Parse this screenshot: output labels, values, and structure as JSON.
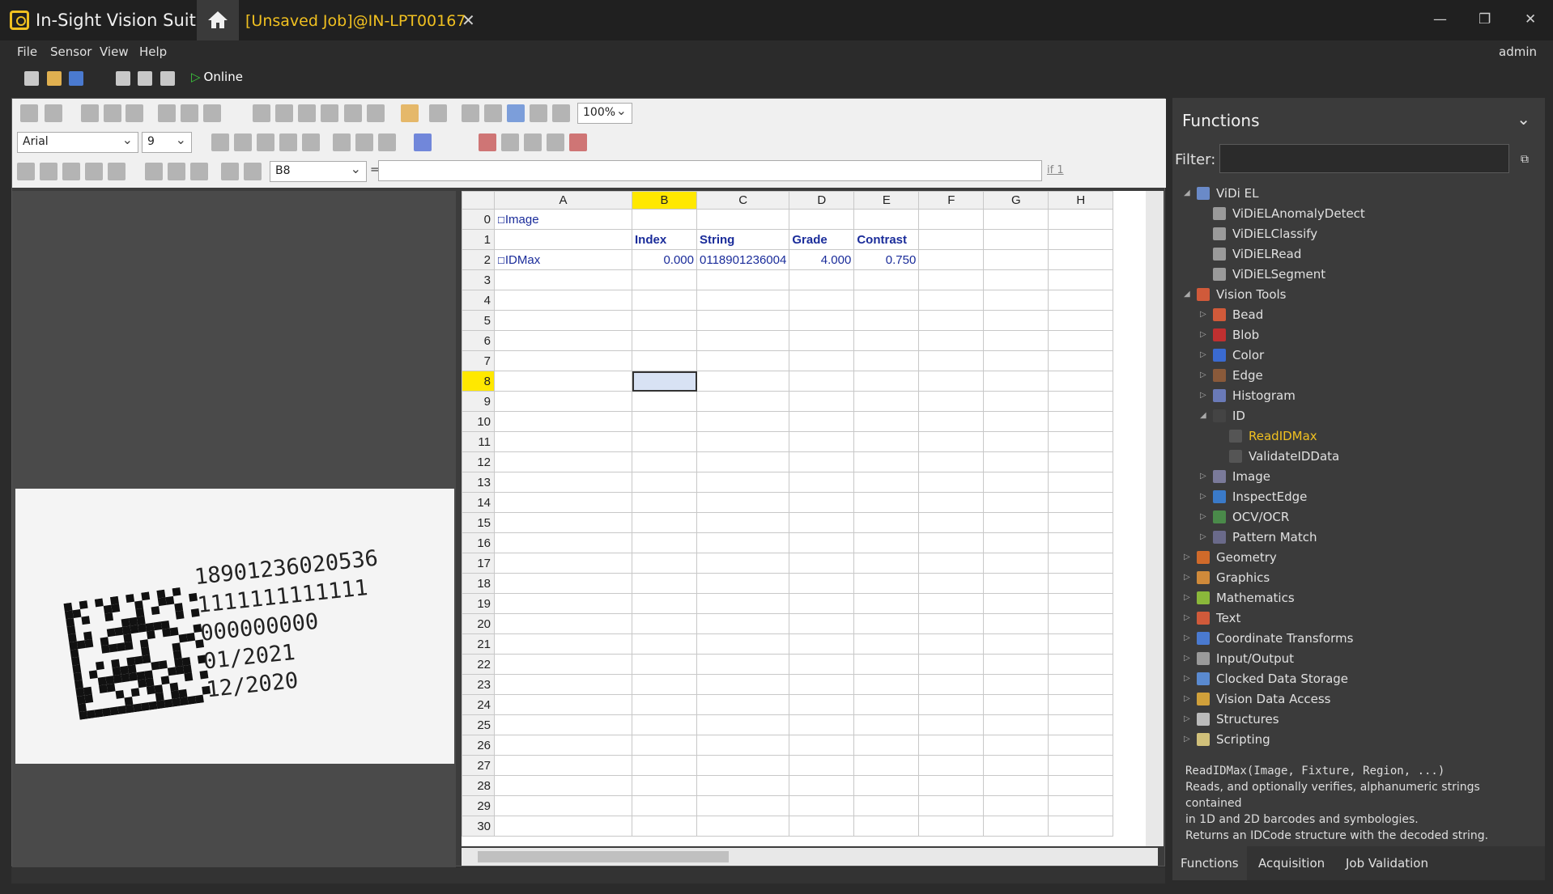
{
  "app": {
    "title": "In-Sight Vision Suite",
    "job_tab": "[Unsaved Job]@IN-LPT00167",
    "user": "admin"
  },
  "menu": [
    "File",
    "Sensor",
    "View",
    "Help"
  ],
  "toolbar": {
    "online_label": "Online",
    "zoom": "100%",
    "font": "Arial",
    "font_size": "9",
    "cell_ref": "B8",
    "equals": "=",
    "iff_label": "if 1"
  },
  "image_text": [
    "18901236020536",
    "1111111111111",
    "000000000",
    "01/2021",
    "12/2020"
  ],
  "sheet": {
    "columns": [
      "A",
      "B",
      "C",
      "D",
      "E",
      "F",
      "G",
      "H"
    ],
    "selected_col": "B",
    "selected_row": 8,
    "rows": [
      {
        "n": "0",
        "cells": [
          "Image",
          "",
          "",
          "",
          "",
          "",
          "",
          ""
        ]
      },
      {
        "n": "1",
        "cells": [
          "",
          "Index",
          "String",
          "Grade",
          "Contrast",
          "",
          "",
          ""
        ]
      },
      {
        "n": "2",
        "cells": [
          "IDMax",
          "0.000",
          "0118901236004",
          "4.000",
          "0.750",
          "",
          "",
          ""
        ]
      }
    ],
    "empty_row_count_to": 30
  },
  "functions": {
    "title": "Functions",
    "filter_label": "Filter:",
    "tree": [
      {
        "label": "ViDi EL",
        "level": 0,
        "expanded": true,
        "color": "#6a8ac8"
      },
      {
        "label": "ViDiELAnomalyDetect",
        "level": 1,
        "color": "#9a9a9a"
      },
      {
        "label": "ViDiELClassify",
        "level": 1,
        "color": "#9a9a9a"
      },
      {
        "label": "ViDiELRead",
        "level": 1,
        "color": "#9a9a9a"
      },
      {
        "label": "ViDiELSegment",
        "level": 1,
        "color": "#9a9a9a"
      },
      {
        "label": "Vision Tools",
        "level": 0,
        "expanded": true,
        "color": "#d05a3a"
      },
      {
        "label": "Bead",
        "level": 1,
        "collapsed": true,
        "color": "#d05a3a"
      },
      {
        "label": "Blob",
        "level": 1,
        "collapsed": true,
        "color": "#c03030"
      },
      {
        "label": "Color",
        "level": 1,
        "collapsed": true,
        "color": "#3a6ad0"
      },
      {
        "label": "Edge",
        "level": 1,
        "collapsed": true,
        "color": "#8a5a3a"
      },
      {
        "label": "Histogram",
        "level": 1,
        "collapsed": true,
        "color": "#6a7ab8"
      },
      {
        "label": "ID",
        "level": 1,
        "expanded": true,
        "color": "#444"
      },
      {
        "label": "ReadIDMax",
        "level": 2,
        "color": "#555",
        "highlight": true
      },
      {
        "label": "ValidateIDData",
        "level": 2,
        "color": "#555"
      },
      {
        "label": "Image",
        "level": 1,
        "collapsed": true,
        "color": "#7a7a9a"
      },
      {
        "label": "InspectEdge",
        "level": 1,
        "collapsed": true,
        "color": "#3a7ac8"
      },
      {
        "label": "OCV/OCR",
        "level": 1,
        "collapsed": true,
        "color": "#4a8a4a"
      },
      {
        "label": "Pattern Match",
        "level": 1,
        "collapsed": true,
        "color": "#6a6a8a"
      },
      {
        "label": "Geometry",
        "level": 0,
        "collapsed": true,
        "color": "#d06a2a"
      },
      {
        "label": "Graphics",
        "level": 0,
        "collapsed": true,
        "color": "#d08a3a"
      },
      {
        "label": "Mathematics",
        "level": 0,
        "collapsed": true,
        "color": "#8ab83a"
      },
      {
        "label": "Text",
        "level": 0,
        "collapsed": true,
        "color": "#d05a3a"
      },
      {
        "label": "Coordinate Transforms",
        "level": 0,
        "collapsed": true,
        "color": "#4a7ad0"
      },
      {
        "label": "Input/Output",
        "level": 0,
        "collapsed": true,
        "color": "#9a9a9a"
      },
      {
        "label": "Clocked Data Storage",
        "level": 0,
        "collapsed": true,
        "color": "#5a8ad0"
      },
      {
        "label": "Vision Data Access",
        "level": 0,
        "collapsed": true,
        "color": "#d0a03a"
      },
      {
        "label": "Structures",
        "level": 0,
        "collapsed": true,
        "color": "#bbbbbb"
      },
      {
        "label": "Scripting",
        "level": 0,
        "collapsed": true,
        "color": "#d0c07a"
      }
    ],
    "description": {
      "signature": "ReadIDMax(Image, Fixture, Region, ...)",
      "line1": "Reads, and optionally verifies, alphanumeric strings contained",
      "line2": "in 1D and 2D barcodes and symbologies.",
      "line3": "Returns an IDCode structure with the decoded string."
    },
    "tabs": [
      "Functions",
      "Acquisition",
      "Job Validation"
    ]
  },
  "colors": {
    "accent": "#f0c020",
    "selection": "#ffe800",
    "tree_highlight": "#f0c020"
  }
}
